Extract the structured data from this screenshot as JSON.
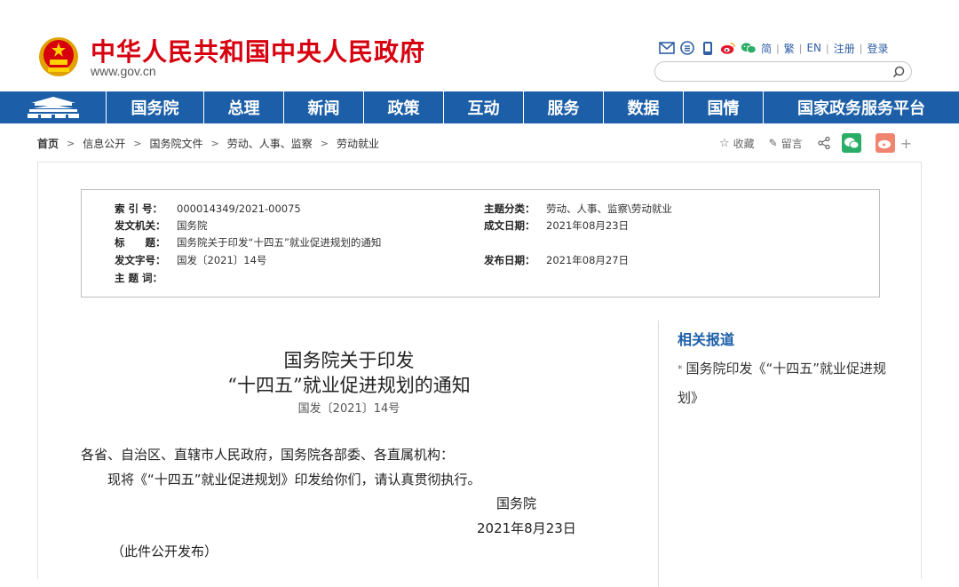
{
  "header": {
    "site_title": "中华人民共和国中央人民政府",
    "site_url": "www.gov.cn",
    "tools": {
      "icons": [
        "mail-icon",
        "rss-icon",
        "mobile-icon",
        "weibo-icon",
        "wechat-icon"
      ],
      "links": [
        "简",
        "繁",
        "EN",
        "注册",
        "登录"
      ]
    },
    "search_placeholder": ""
  },
  "nav": {
    "items": [
      "国务院",
      "总理",
      "新闻",
      "政策",
      "互动",
      "服务",
      "数据",
      "国情",
      "国家政务服务平台"
    ]
  },
  "breadcrumb": [
    "首页",
    "信息公开",
    "国务院文件",
    "劳动、人事、监察",
    "劳动就业"
  ],
  "share": {
    "favorite": "收藏",
    "comment": "留言",
    "plus": "+"
  },
  "meta": {
    "index_label": "索 引 号：",
    "index_value": "000014349/2021-00075",
    "topic_label": "主题分类：",
    "topic_value": "劳动、人事、监察\\劳动就业",
    "issuer_label": "发文机关：",
    "issuer_value": "国务院",
    "written_label": "成文日期：",
    "written_value": "2021年08月23日",
    "title_label": "标　　题：",
    "title_value": "国务院关于印发“十四五”就业促进规划的通知",
    "docno_label": "发文字号：",
    "docno_value": "国发〔2021〕14号",
    "published_label": "发布日期：",
    "published_value": "2021年08月27日",
    "keywords_label": "主 题 词：",
    "keywords_value": ""
  },
  "article": {
    "title_line1": "国务院关于印发",
    "title_line2": "“十四五”就业促进规划的通知",
    "doc_number": "国发〔2021〕14号",
    "salutation": "各省、自治区、直辖市人民政府，国务院各部委、各直属机构：",
    "body": "现将《“十四五”就业促进规划》印发给你们，请认真贯彻执行。",
    "signature": "国务院",
    "date": "2021年8月23日",
    "note": "（此件公开发布）"
  },
  "related": {
    "title": "相关报道",
    "items": [
      "国务院印发《“十四五”就业促进规划》"
    ]
  },
  "colors": {
    "brand_red": "#d7000f",
    "nav_blue": "#1c5fa8",
    "link_blue": "#2f5fa6"
  }
}
